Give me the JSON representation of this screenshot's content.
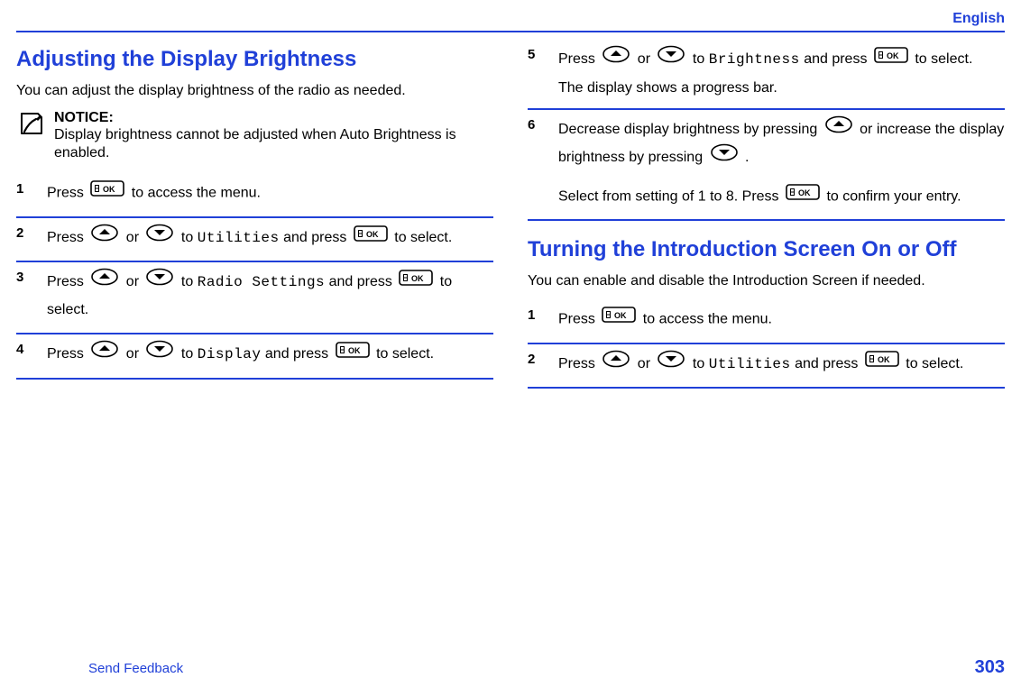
{
  "lang": "English",
  "section1": {
    "title": "Adjusting the Display Brightness",
    "intro": "You can adjust the display brightness of the radio as needed.",
    "notice_title": "NOTICE:",
    "notice_body": "Display brightness cannot be adjusted when Auto Brightness is enabled.",
    "steps": {
      "s1": {
        "n": "1",
        "a": "Press ",
        "b": " to access the menu."
      },
      "s2": {
        "n": "2",
        "a": "Press ",
        "b": " or ",
        "c": " to ",
        "d": "Utilities",
        "e": " and press ",
        "f": " to select."
      },
      "s3": {
        "n": "3",
        "a": "Press ",
        "b": " or ",
        "c": " to ",
        "d": "Radio Settings",
        "e": " and press ",
        "f": " to select."
      },
      "s4": {
        "n": "4",
        "a": "Press ",
        "b": " or ",
        "c": " to ",
        "d": "Display",
        "e": " and press ",
        "f": " to select."
      },
      "s5": {
        "n": "5",
        "a": "Press ",
        "b": " or ",
        "c": " to ",
        "d": "Brightness",
        "e": " and press ",
        "f": " to select.",
        "g": "The display shows a progress bar."
      },
      "s6": {
        "n": "6",
        "a": "Decrease display brightness by pressing ",
        "b": " or increase the display brightness by pressing ",
        "c": " .",
        "d": "Select from setting of 1 to 8. Press ",
        "e": " to confirm your entry."
      }
    }
  },
  "section2": {
    "title": "Turning the Introduction Screen On or Off",
    "intro": "You can enable and disable the Introduction Screen if needed.",
    "steps": {
      "s1": {
        "n": "1",
        "a": "Press ",
        "b": " to access the menu."
      },
      "s2": {
        "n": "2",
        "a": "Press ",
        "b": " or ",
        "c": " to ",
        "d": "Utilities",
        "e": " and press ",
        "f": " to select."
      }
    }
  },
  "footer": {
    "link": "Send Feedback",
    "page": "303"
  }
}
